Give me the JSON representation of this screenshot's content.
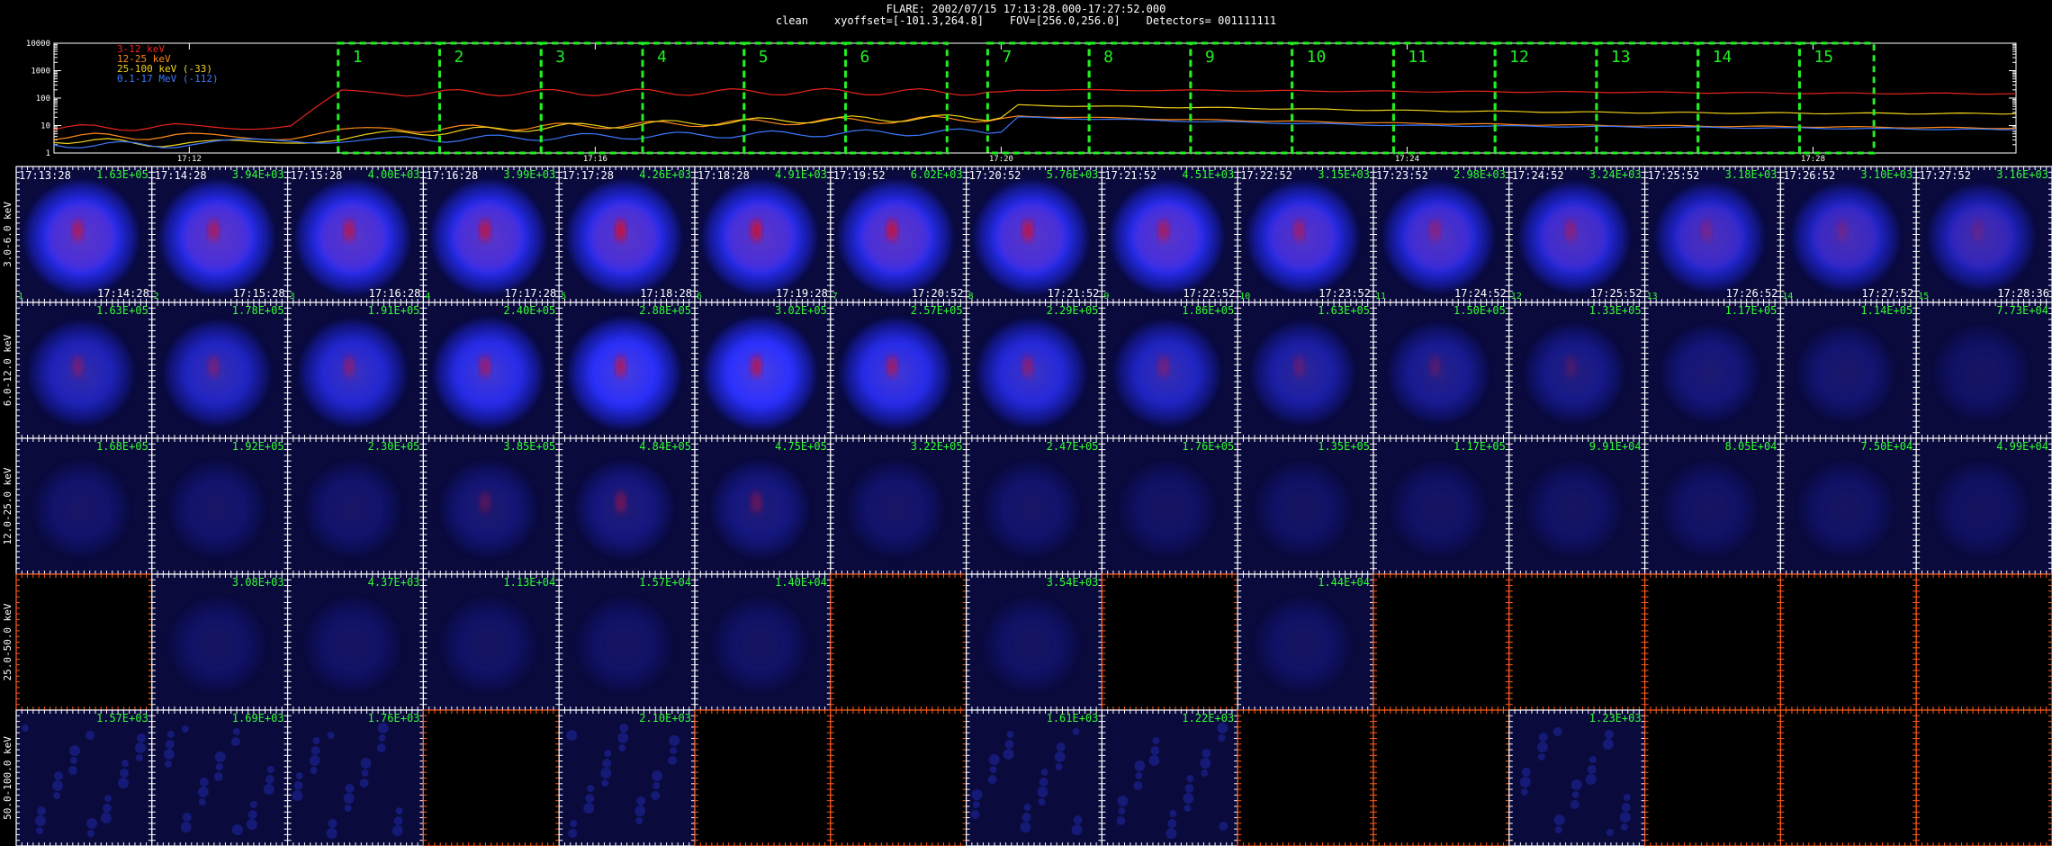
{
  "header": {
    "line1": "FLARE: 2002/07/15 17:13:28.000-17:27:52.000",
    "line2": "clean    xyoffset=[-101.3,264.8]    FOV=[256.0,256.0]    Detectors= 001111111"
  },
  "colors": {
    "frame": "#ffffff",
    "empty_frame": "#ff5a1e",
    "interval_box": "#22ee22",
    "counts_text": "#33ff33",
    "disk": "#2233ff",
    "core": "#cc1133"
  },
  "chart_data": [
    {
      "type": "line",
      "title": "",
      "ylabel": "",
      "yscale": "log",
      "ylim": [
        1,
        10000
      ],
      "yticks": [
        "1",
        "10",
        "100",
        "1000",
        "10000"
      ],
      "xlim": [
        "17:10:40",
        "17:30:00"
      ],
      "xticks": [
        "17:12",
        "17:16",
        "17:20",
        "17:24",
        "17:28"
      ],
      "x": [
        "17:10:40",
        "17:12:00",
        "17:13:00",
        "17:13:30",
        "17:14:00",
        "17:16:00",
        "17:18:00",
        "17:20:00",
        "17:20:10",
        "17:22:00",
        "17:24:00",
        "17:26:00",
        "17:28:00",
        "17:30:00"
      ],
      "series": [
        {
          "name": "3-12 keV",
          "color": "#e8241c",
          "values": [
            8,
            9,
            10,
            150,
            155,
            160,
            170,
            165,
            200,
            190,
            175,
            165,
            150,
            145
          ]
        },
        {
          "name": "12-25 keV",
          "color": "#ff8a1a",
          "values": [
            4,
            4,
            4,
            6,
            7,
            10,
            14,
            18,
            22,
            16,
            12,
            10,
            9,
            8
          ]
        },
        {
          "name": "25-100 keV (-33)",
          "color": "#f2d21a",
          "values": [
            3,
            2,
            3,
            3,
            5,
            10,
            16,
            20,
            55,
            45,
            35,
            30,
            28,
            27
          ]
        },
        {
          "name": "0.1-17 MeV (-112)",
          "color": "#3b78ff",
          "values": [
            2,
            2,
            3,
            3,
            3,
            4,
            5,
            6,
            20,
            14,
            10,
            9,
            8,
            7
          ]
        }
      ],
      "intervals": [
        "1",
        "2",
        "3",
        "4",
        "5",
        "6",
        "7",
        "8",
        "9",
        "10",
        "11",
        "12",
        "13",
        "14",
        "15"
      ],
      "interval_bounds": [
        [
          "17:13:28",
          "17:14:28"
        ],
        [
          "17:14:28",
          "17:15:28"
        ],
        [
          "17:15:28",
          "17:16:28"
        ],
        [
          "17:16:28",
          "17:17:28"
        ],
        [
          "17:17:28",
          "17:18:28"
        ],
        [
          "17:18:28",
          "17:19:28"
        ],
        [
          "17:19:52",
          "17:20:52"
        ],
        [
          "17:20:52",
          "17:21:52"
        ],
        [
          "17:21:52",
          "17:22:52"
        ],
        [
          "17:22:52",
          "17:23:52"
        ],
        [
          "17:23:52",
          "17:24:52"
        ],
        [
          "17:24:52",
          "17:25:52"
        ],
        [
          "17:25:52",
          "17:26:52"
        ],
        [
          "17:26:52",
          "17:27:52"
        ],
        [
          "17:27:52",
          "17:28:36"
        ]
      ],
      "grid": false,
      "legend_position": "top-left"
    },
    {
      "type": "heatmap",
      "title": "",
      "columns": [
        {
          "start": "17:13:28",
          "end": "17:14:28",
          "index": "1"
        },
        {
          "start": "17:14:28",
          "end": "17:15:28",
          "index": "2"
        },
        {
          "start": "17:15:28",
          "end": "17:16:28",
          "index": "3"
        },
        {
          "start": "17:16:28",
          "end": "17:17:28",
          "index": "4"
        },
        {
          "start": "17:17:28",
          "end": "17:18:28",
          "index": "5"
        },
        {
          "start": "17:18:28",
          "end": "17:19:28",
          "index": "6"
        },
        {
          "start": "17:19:52",
          "end": "17:20:52",
          "index": "7"
        },
        {
          "start": "17:20:52",
          "end": "17:21:52",
          "index": "8"
        },
        {
          "start": "17:21:52",
          "end": "17:22:52",
          "index": "9"
        },
        {
          "start": "17:22:52",
          "end": "17:23:52",
          "index": "10"
        },
        {
          "start": "17:23:52",
          "end": "17:24:52",
          "index": "11"
        },
        {
          "start": "17:24:52",
          "end": "17:25:52",
          "index": "12"
        },
        {
          "start": "17:25:52",
          "end": "17:26:52",
          "index": "13"
        },
        {
          "start": "17:26:52",
          "end": "17:27:52",
          "index": "14"
        },
        {
          "start": "17:27:52",
          "end": "17:28:36",
          "index": "15"
        }
      ],
      "rows": [
        {
          "label": "3.0-6.0 keV",
          "values": [
            "1.63E+05",
            "3.94E+03",
            "4.00E+03",
            "3.99E+03",
            "4.26E+03",
            "4.91E+03",
            "6.02E+03",
            "5.76E+03",
            "4.51E+03",
            "3.15E+03",
            "2.98E+03",
            "3.24E+03",
            "3.18E+03",
            "3.10E+03",
            "3.16E+03"
          ],
          "intensity": [
            1.0,
            1.0,
            1.0,
            1.0,
            1.0,
            1.0,
            1.0,
            0.98,
            0.92,
            0.85,
            0.8,
            0.78,
            0.72,
            0.68,
            0.6
          ],
          "core": [
            0.5,
            0.5,
            0.55,
            0.65,
            0.75,
            0.75,
            0.7,
            0.65,
            0.5,
            0.4,
            0.3,
            0.3,
            0.15,
            0.1,
            0.05
          ]
        },
        {
          "label": "6.0-12.0 keV",
          "values": [
            "1.63E+05",
            "1.78E+05",
            "1.91E+05",
            "2.40E+05",
            "2.88E+05",
            "3.02E+05",
            "2.57E+05",
            "2.29E+05",
            "1.86E+05",
            "1.63E+05",
            "1.50E+05",
            "1.33E+05",
            "1.17E+05",
            "1.14E+05",
            "7.73E+04"
          ],
          "intensity": [
            0.55,
            0.6,
            0.68,
            0.8,
            0.88,
            0.92,
            0.8,
            0.72,
            0.6,
            0.45,
            0.35,
            0.3,
            0.22,
            0.18,
            0.12
          ],
          "core": [
            0.25,
            0.25,
            0.3,
            0.45,
            0.55,
            0.6,
            0.5,
            0.35,
            0.25,
            0.15,
            0.1,
            0.05,
            0,
            0,
            0
          ]
        },
        {
          "label": "12.0-25.0 keV",
          "values": [
            "1.68E+05",
            "1.92E+05",
            "2.30E+05",
            "3.85E+05",
            "4.84E+05",
            "4.75E+05",
            "3.22E+05",
            "2.47E+05",
            "1.76E+05",
            "1.35E+05",
            "1.17E+05",
            "9.91E+04",
            "8.05E+04",
            "7.50E+04",
            "4.99E+04"
          ],
          "intensity": [
            0.15,
            0.15,
            0.15,
            0.2,
            0.25,
            0.25,
            0.15,
            0.15,
            0.12,
            0.12,
            0.12,
            0.12,
            0.12,
            0.12,
            0.1
          ],
          "core": [
            0,
            0,
            0,
            0.15,
            0.3,
            0.25,
            0,
            0,
            0,
            0,
            0,
            0,
            0,
            0,
            0
          ]
        },
        {
          "label": "25.0-50.0 keV",
          "values": [
            "",
            "3.08E+03",
            "4.37E+03",
            "1.13E+04",
            "1.57E+04",
            "1.40E+04",
            "",
            "3.54E+03",
            "",
            "1.44E+04",
            "",
            "",
            "",
            "",
            ""
          ],
          "intensity": [
            0,
            0.12,
            0.12,
            0.12,
            0.12,
            0.12,
            0,
            0.12,
            0,
            0.12,
            0,
            0,
            0,
            0,
            0
          ],
          "core": [
            0,
            0,
            0,
            0,
            0,
            0,
            0,
            0,
            0,
            0,
            0,
            0,
            0,
            0,
            0
          ]
        },
        {
          "label": "50.0-100.0 keV",
          "values": [
            "1.57E+03",
            "1.69E+03",
            "1.76E+03",
            "",
            "2.10E+03",
            "",
            "",
            "1.61E+03",
            "1.22E+03",
            "",
            "",
            "1.23E+03",
            "",
            "",
            ""
          ],
          "intensity": [
            0.2,
            0.18,
            0.18,
            0,
            0.2,
            0,
            0,
            0.15,
            0.15,
            0,
            0,
            0.15,
            0,
            0,
            0
          ],
          "core": [
            0,
            0,
            0,
            0,
            0,
            0,
            0,
            0,
            0,
            0,
            0,
            0,
            0,
            0,
            0
          ]
        }
      ]
    }
  ]
}
